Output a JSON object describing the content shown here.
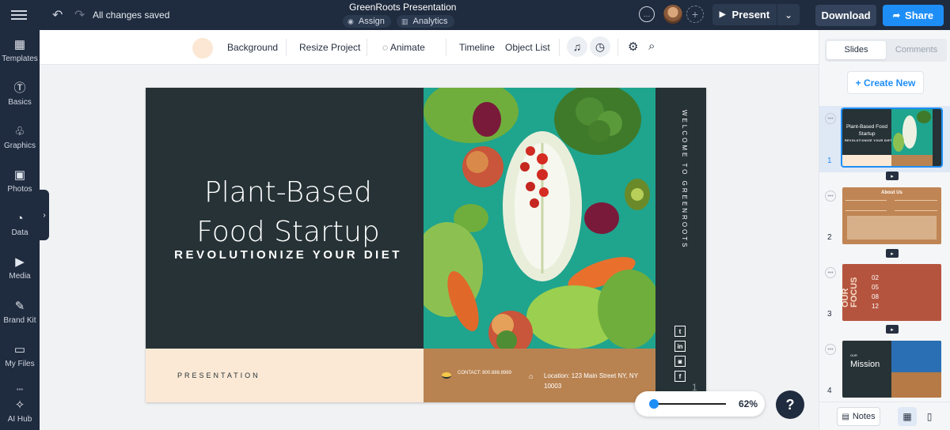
{
  "topbar": {
    "status": "All changes saved",
    "doc_title": "GreenRoots Presentation",
    "assign_label": "Assign",
    "analytics_label": "Analytics",
    "present_label": "Present",
    "download_label": "Download",
    "share_label": "Share"
  },
  "sidebar": {
    "items": [
      {
        "label": "Templates",
        "icon": "templates-icon"
      },
      {
        "label": "Basics",
        "icon": "basics-icon"
      },
      {
        "label": "Graphics",
        "icon": "graphics-icon"
      },
      {
        "label": "Photos",
        "icon": "photos-icon"
      },
      {
        "label": "Data",
        "icon": "data-icon"
      },
      {
        "label": "Media",
        "icon": "media-icon"
      },
      {
        "label": "Brand Kit",
        "icon": "brand-kit-icon"
      },
      {
        "label": "My Files",
        "icon": "folder-icon"
      },
      {
        "label": "AI Hub",
        "icon": "ai-hub-icon"
      }
    ]
  },
  "toolbar": {
    "background_label": "Background",
    "resize_label": "Resize Project",
    "animate_label": "Animate",
    "timeline_label": "Timeline",
    "object_list_label": "Object List",
    "swatch_color": "#fbe7d4"
  },
  "slide": {
    "title_line1": "Plant-Based",
    "title_line2": "Food Startup",
    "subtitle": "REVOLUTIONIZE YOUR DIET",
    "presentation_label": "PRESENTATION",
    "vertical_text": "WELCOME TO GREENROOTS",
    "contact": "CONTACT: 800.888.8989",
    "location": "Location: 123 Main Street NY, NY 10003",
    "page_number": "1",
    "colors": {
      "dark": "#263236",
      "peach": "#fbe9d6",
      "brown": "#b98351",
      "teal": "#1fa48e"
    }
  },
  "zoom": {
    "value": "62%",
    "level": 0.04
  },
  "right_panel": {
    "tab_slides": "Slides",
    "tab_comments": "Comments",
    "create_new": "+ Create New",
    "thumbs": [
      {
        "num": "1",
        "title": "Plant-Based Food Startup",
        "sub": "REVOLUTIONIZE YOUR DIET"
      },
      {
        "num": "2",
        "title": "About Us"
      },
      {
        "num": "3",
        "title": "OUR FOCUS",
        "items": [
          "02",
          "05",
          "08",
          "12"
        ]
      },
      {
        "num": "4",
        "title": "Mission",
        "kicker": "OUR"
      }
    ],
    "notes_label": "Notes"
  }
}
